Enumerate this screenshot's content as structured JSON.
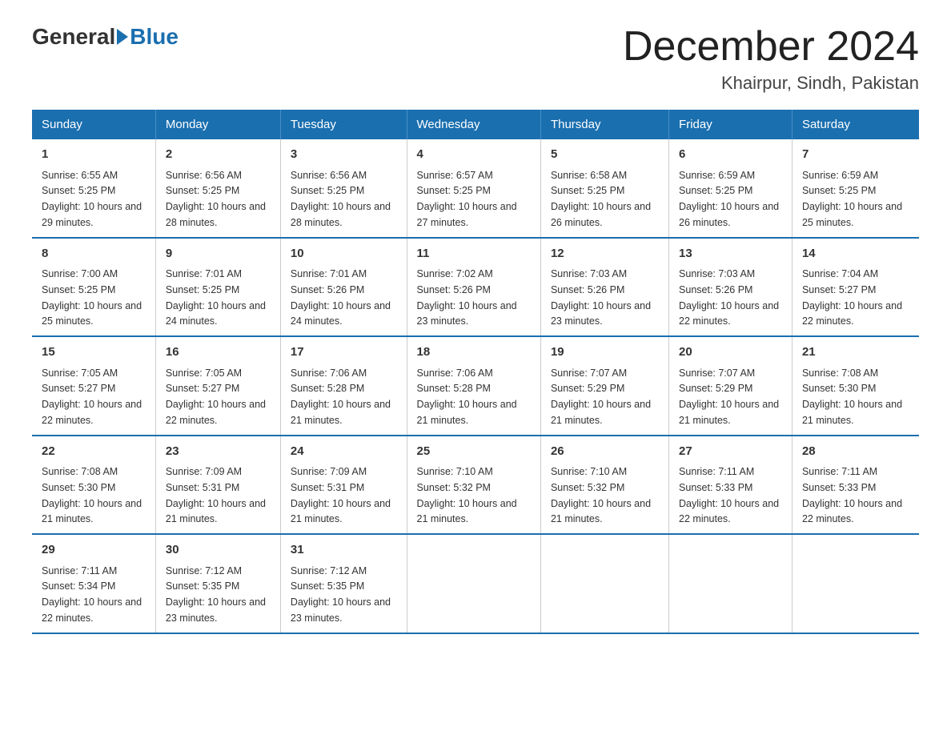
{
  "logo": {
    "general": "General",
    "blue": "Blue"
  },
  "title": "December 2024",
  "location": "Khairpur, Sindh, Pakistan",
  "weekdays": [
    "Sunday",
    "Monday",
    "Tuesday",
    "Wednesday",
    "Thursday",
    "Friday",
    "Saturday"
  ],
  "weeks": [
    [
      {
        "day": "1",
        "sunrise": "6:55 AM",
        "sunset": "5:25 PM",
        "daylight": "10 hours and 29 minutes."
      },
      {
        "day": "2",
        "sunrise": "6:56 AM",
        "sunset": "5:25 PM",
        "daylight": "10 hours and 28 minutes."
      },
      {
        "day": "3",
        "sunrise": "6:56 AM",
        "sunset": "5:25 PM",
        "daylight": "10 hours and 28 minutes."
      },
      {
        "day": "4",
        "sunrise": "6:57 AM",
        "sunset": "5:25 PM",
        "daylight": "10 hours and 27 minutes."
      },
      {
        "day": "5",
        "sunrise": "6:58 AM",
        "sunset": "5:25 PM",
        "daylight": "10 hours and 26 minutes."
      },
      {
        "day": "6",
        "sunrise": "6:59 AM",
        "sunset": "5:25 PM",
        "daylight": "10 hours and 26 minutes."
      },
      {
        "day": "7",
        "sunrise": "6:59 AM",
        "sunset": "5:25 PM",
        "daylight": "10 hours and 25 minutes."
      }
    ],
    [
      {
        "day": "8",
        "sunrise": "7:00 AM",
        "sunset": "5:25 PM",
        "daylight": "10 hours and 25 minutes."
      },
      {
        "day": "9",
        "sunrise": "7:01 AM",
        "sunset": "5:25 PM",
        "daylight": "10 hours and 24 minutes."
      },
      {
        "day": "10",
        "sunrise": "7:01 AM",
        "sunset": "5:26 PM",
        "daylight": "10 hours and 24 minutes."
      },
      {
        "day": "11",
        "sunrise": "7:02 AM",
        "sunset": "5:26 PM",
        "daylight": "10 hours and 23 minutes."
      },
      {
        "day": "12",
        "sunrise": "7:03 AM",
        "sunset": "5:26 PM",
        "daylight": "10 hours and 23 minutes."
      },
      {
        "day": "13",
        "sunrise": "7:03 AM",
        "sunset": "5:26 PM",
        "daylight": "10 hours and 22 minutes."
      },
      {
        "day": "14",
        "sunrise": "7:04 AM",
        "sunset": "5:27 PM",
        "daylight": "10 hours and 22 minutes."
      }
    ],
    [
      {
        "day": "15",
        "sunrise": "7:05 AM",
        "sunset": "5:27 PM",
        "daylight": "10 hours and 22 minutes."
      },
      {
        "day": "16",
        "sunrise": "7:05 AM",
        "sunset": "5:27 PM",
        "daylight": "10 hours and 22 minutes."
      },
      {
        "day": "17",
        "sunrise": "7:06 AM",
        "sunset": "5:28 PM",
        "daylight": "10 hours and 21 minutes."
      },
      {
        "day": "18",
        "sunrise": "7:06 AM",
        "sunset": "5:28 PM",
        "daylight": "10 hours and 21 minutes."
      },
      {
        "day": "19",
        "sunrise": "7:07 AM",
        "sunset": "5:29 PM",
        "daylight": "10 hours and 21 minutes."
      },
      {
        "day": "20",
        "sunrise": "7:07 AM",
        "sunset": "5:29 PM",
        "daylight": "10 hours and 21 minutes."
      },
      {
        "day": "21",
        "sunrise": "7:08 AM",
        "sunset": "5:30 PM",
        "daylight": "10 hours and 21 minutes."
      }
    ],
    [
      {
        "day": "22",
        "sunrise": "7:08 AM",
        "sunset": "5:30 PM",
        "daylight": "10 hours and 21 minutes."
      },
      {
        "day": "23",
        "sunrise": "7:09 AM",
        "sunset": "5:31 PM",
        "daylight": "10 hours and 21 minutes."
      },
      {
        "day": "24",
        "sunrise": "7:09 AM",
        "sunset": "5:31 PM",
        "daylight": "10 hours and 21 minutes."
      },
      {
        "day": "25",
        "sunrise": "7:10 AM",
        "sunset": "5:32 PM",
        "daylight": "10 hours and 21 minutes."
      },
      {
        "day": "26",
        "sunrise": "7:10 AM",
        "sunset": "5:32 PM",
        "daylight": "10 hours and 21 minutes."
      },
      {
        "day": "27",
        "sunrise": "7:11 AM",
        "sunset": "5:33 PM",
        "daylight": "10 hours and 22 minutes."
      },
      {
        "day": "28",
        "sunrise": "7:11 AM",
        "sunset": "5:33 PM",
        "daylight": "10 hours and 22 minutes."
      }
    ],
    [
      {
        "day": "29",
        "sunrise": "7:11 AM",
        "sunset": "5:34 PM",
        "daylight": "10 hours and 22 minutes."
      },
      {
        "day": "30",
        "sunrise": "7:12 AM",
        "sunset": "5:35 PM",
        "daylight": "10 hours and 23 minutes."
      },
      {
        "day": "31",
        "sunrise": "7:12 AM",
        "sunset": "5:35 PM",
        "daylight": "10 hours and 23 minutes."
      },
      null,
      null,
      null,
      null
    ]
  ]
}
